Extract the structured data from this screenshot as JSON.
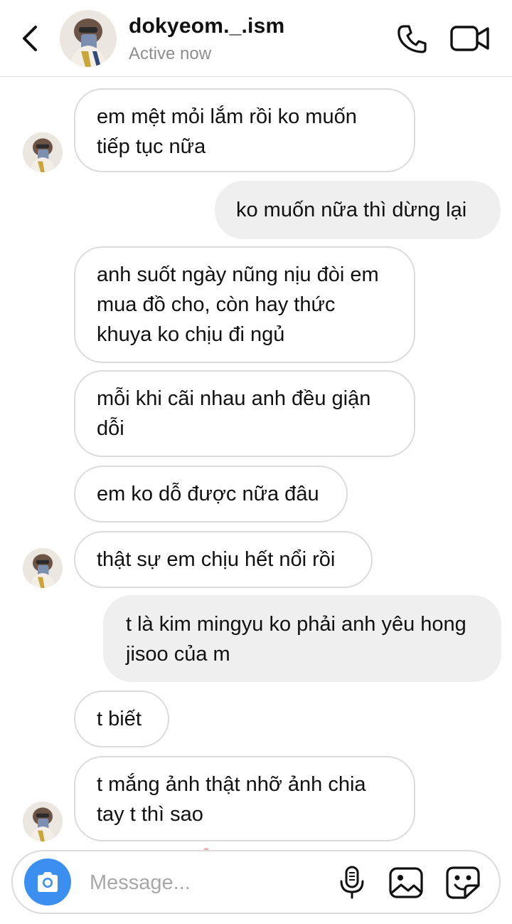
{
  "header": {
    "username": "dokyeom._.ism",
    "status": "Active now",
    "back_icon": "chevron-left-icon",
    "call_icon": "phone-icon",
    "video_icon": "video-camera-icon"
  },
  "messages": [
    {
      "side": "received",
      "text": "em mệt mỏi lắm rồi ko muốn tiếp tục nữa"
    },
    {
      "side": "sent",
      "text": "ko muốn nữa thì dừng lại"
    },
    {
      "side": "received",
      "text": "anh suốt ngày nũng nịu đòi em mua đồ cho, còn hay thức khuya ko chịu đi ngủ"
    },
    {
      "side": "received",
      "text": "mỗi khi cãi nhau anh đều giận dỗi"
    },
    {
      "side": "received",
      "text": "em ko dỗ được nữa đâu"
    },
    {
      "side": "received",
      "text": "thật sự em chịu hết nổi rồi"
    },
    {
      "side": "sent",
      "text": "t là kim mingyu ko phải anh yêu hong jisoo của m"
    },
    {
      "side": "received",
      "text": "t biết"
    },
    {
      "side": "received",
      "text": "t mắng ảnh thật nhỡ ảnh chia tay t thì sao"
    }
  ],
  "composer": {
    "placeholder": "Message...",
    "camera_icon": "camera-icon",
    "mic_icon": "microphone-icon",
    "gallery_icon": "image-icon",
    "sticker_icon": "sticker-icon",
    "accent_color": "#3b8ff0"
  },
  "colors": {
    "sent_bubble": "#efefef",
    "received_border": "#dbdbdb",
    "muted_text": "#8e8e8e"
  }
}
